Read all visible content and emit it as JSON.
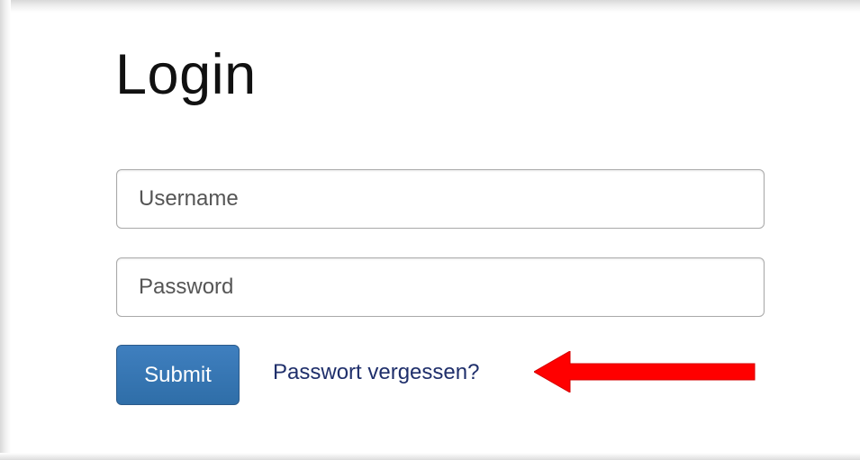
{
  "login": {
    "title": "Login",
    "username_placeholder": "Username",
    "password_placeholder": "Password",
    "submit_label": "Submit",
    "forgot_password_label": "Passwort vergessen?"
  },
  "colors": {
    "primary_button": "#337ab7",
    "link": "#1f2f6b",
    "annotation_arrow": "#ff0000"
  },
  "icons": {
    "annotation": "left-arrow-icon"
  }
}
